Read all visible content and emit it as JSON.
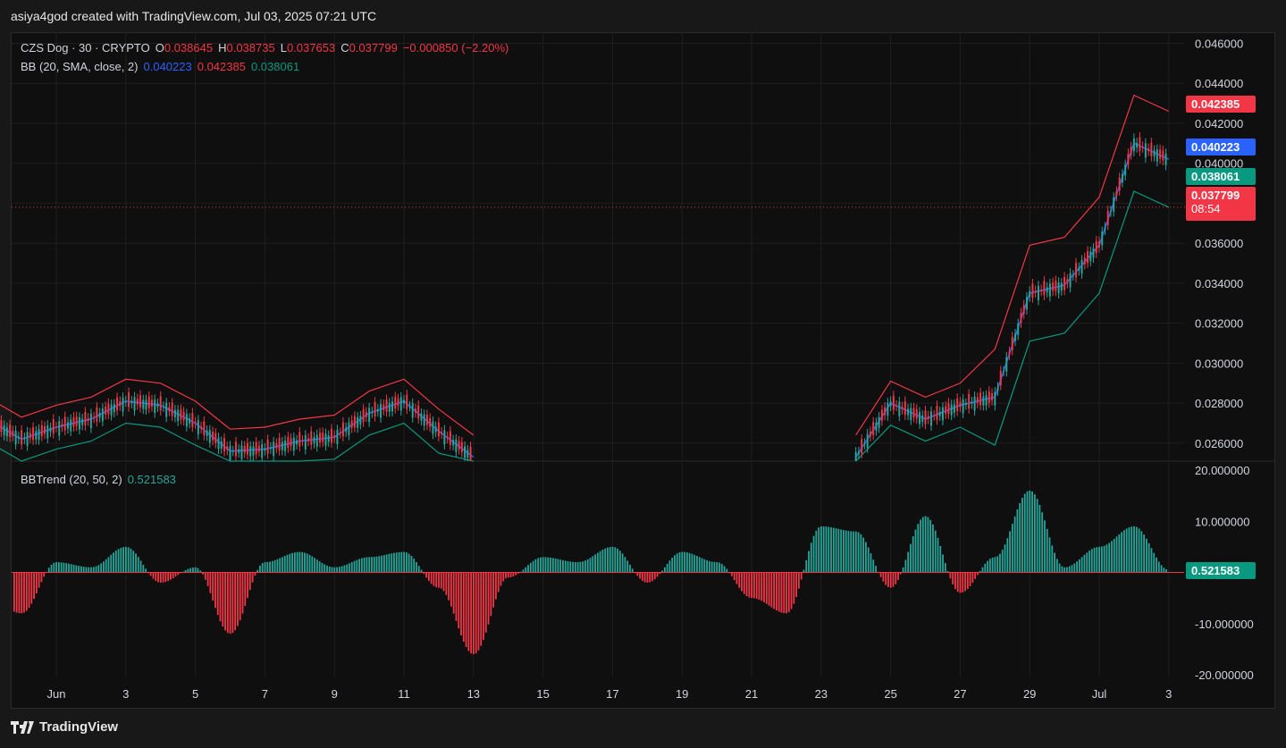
{
  "header": {
    "text": "asiya4god created with TradingView.com, Jul 03, 2025 07:21 UTC"
  },
  "legend": {
    "symbol": "CZS Dog · 30 · CRYPTO",
    "o_label": "O",
    "o": "0.038645",
    "h_label": "H",
    "h": "0.038735",
    "l_label": "L",
    "l": "0.037653",
    "c_label": "C",
    "c": "0.037799",
    "change": "−0.000850 (−2.20%)",
    "bb_label": "BB (20, SMA, close, 2)",
    "bb_basis": "0.040223",
    "bb_upper": "0.042385",
    "bb_lower": "0.038061",
    "bbtrend_label": "BBTrend (20, 50, 2)",
    "bbtrend_value": "0.521583"
  },
  "price_tags": {
    "upper": "0.042385",
    "basis": "0.040223",
    "lower": "0.038061",
    "last": "0.037799",
    "countdown": "08:54",
    "bbtrend": "0.521583"
  },
  "colors": {
    "up": "#26a69a",
    "down": "#f23645",
    "basis": "#2962ff",
    "upper": "#f23645",
    "lower": "#089981",
    "grid": "#1f1f1f",
    "axis_text": "#d1d4dc"
  },
  "footer": {
    "brand": "TradingView",
    "icon": "tradingview-logo-icon"
  },
  "chart_data": {
    "type": "line",
    "price_axis": {
      "ticks": [
        "0.046000",
        "0.044000",
        "0.042000",
        "0.040000",
        "0.038000",
        "0.036000",
        "0.034000",
        "0.032000",
        "0.030000",
        "0.028000",
        "0.026000"
      ],
      "range": [
        0.0251,
        0.0462
      ]
    },
    "indicator_axis": {
      "ticks": [
        "20.000000",
        "10.000000",
        "-10.000000",
        "-20.000000"
      ],
      "range": [
        -20,
        20
      ]
    },
    "time_axis": {
      "labels": [
        "Jun",
        "3",
        "5",
        "7",
        "9",
        "11",
        "13",
        "15",
        "17",
        "19",
        "21",
        "23",
        "25",
        "27",
        "29",
        "Jul",
        "3"
      ],
      "dates": [
        "2025-06-01",
        "2025-06-03",
        "2025-06-05",
        "2025-06-07",
        "2025-06-09",
        "2025-06-11",
        "2025-06-13",
        "2025-06-15",
        "2025-06-17",
        "2025-06-19",
        "2025-06-21",
        "2025-06-23",
        "2025-06-25",
        "2025-06-27",
        "2025-06-29",
        "2025-07-01",
        "2025-07-03"
      ]
    },
    "series": [
      {
        "name": "BB",
        "x": [
          "2025-05-30",
          "2025-05-31",
          "2025-06-01",
          "2025-06-02",
          "2025-06-03",
          "2025-06-04",
          "2025-06-05",
          "2025-06-06",
          "2025-06-07",
          "2025-06-08",
          "2025-06-09",
          "2025-06-10",
          "2025-06-11",
          "2025-06-12",
          "2025-06-13",
          "2025-06-24",
          "2025-06-25",
          "2025-06-26",
          "2025-06-27",
          "2025-06-28",
          "2025-06-29",
          "2025-06-30",
          "2025-07-01",
          "2025-07-02",
          "2025-07-03"
        ],
        "values": [
          0.0272,
          0.0262,
          0.0268,
          0.0272,
          0.0281,
          0.0279,
          0.027,
          0.0256,
          0.0257,
          0.0261,
          0.0263,
          0.0275,
          0.0281,
          0.0266,
          0.0253,
          0.0253,
          0.028,
          0.0272,
          0.0279,
          0.0283,
          0.0335,
          0.0339,
          0.0359,
          0.041,
          0.0402
        ]
      }
    ],
    "bbtrend": {
      "x": [
        "2025-05-30",
        "2025-05-31",
        "2025-06-01",
        "2025-06-02",
        "2025-06-03",
        "2025-06-04",
        "2025-06-05",
        "2025-06-06",
        "2025-06-07",
        "2025-06-08",
        "2025-06-09",
        "2025-06-10",
        "2025-06-11",
        "2025-06-12",
        "2025-06-13",
        "2025-06-14",
        "2025-06-15",
        "2025-06-16",
        "2025-06-17",
        "2025-06-18",
        "2025-06-19",
        "2025-06-20",
        "2025-06-21",
        "2025-06-22",
        "2025-06-23",
        "2025-06-24",
        "2025-06-25",
        "2025-06-26",
        "2025-06-27",
        "2025-06-28",
        "2025-06-29",
        "2025-06-30",
        "2025-07-01",
        "2025-07-02",
        "2025-07-03"
      ],
      "values": [
        -5,
        -8,
        2,
        1,
        5,
        -2,
        1,
        -12,
        2,
        4,
        1,
        3,
        4,
        -3,
        -16,
        -1,
        3,
        2,
        5,
        -2,
        4,
        2,
        -5,
        -8,
        9,
        8,
        -3,
        11,
        -4,
        3,
        16,
        1,
        5,
        9,
        0.5
      ]
    }
  }
}
